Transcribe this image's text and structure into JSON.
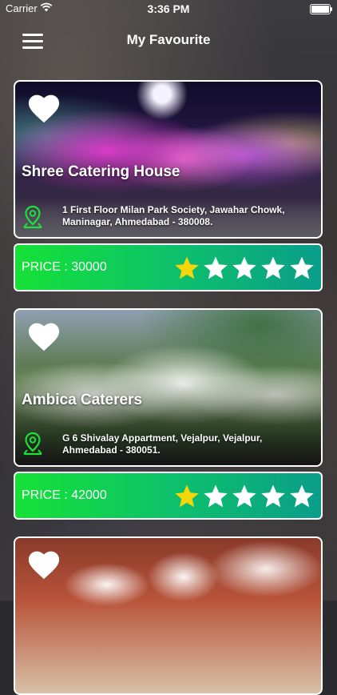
{
  "status": {
    "carrier": "Carrier",
    "time": "3:36 PM"
  },
  "header": {
    "title": "My Favourite"
  },
  "listings": [
    {
      "name": "Shree Catering House",
      "address": "1 First Floor Milan Park Society, Jawahar Chowk, Maninagar, Ahmedabad - 380008.",
      "price": "PRICE : 30000",
      "rating": 1
    },
    {
      "name": "Ambica Caterers",
      "address": "G 6 Shivalay Appartment, Vejalpur, Vejalpur, Ahmedabad - 380051.",
      "price": "PRICE : 42000",
      "rating": 1
    },
    {
      "name": "",
      "address": "",
      "price": "",
      "rating": 0
    }
  ],
  "colors": {
    "accent_start": "#15e236",
    "accent_end": "#0a9d8a",
    "star_filled": "#f5d60a",
    "star_empty": "#ffffff",
    "pin": "#1fe03a"
  },
  "icons": {
    "menu": "hamburger-menu-icon",
    "favourite": "heart-icon",
    "location": "map-pin-icon",
    "rating": "star-icon"
  }
}
